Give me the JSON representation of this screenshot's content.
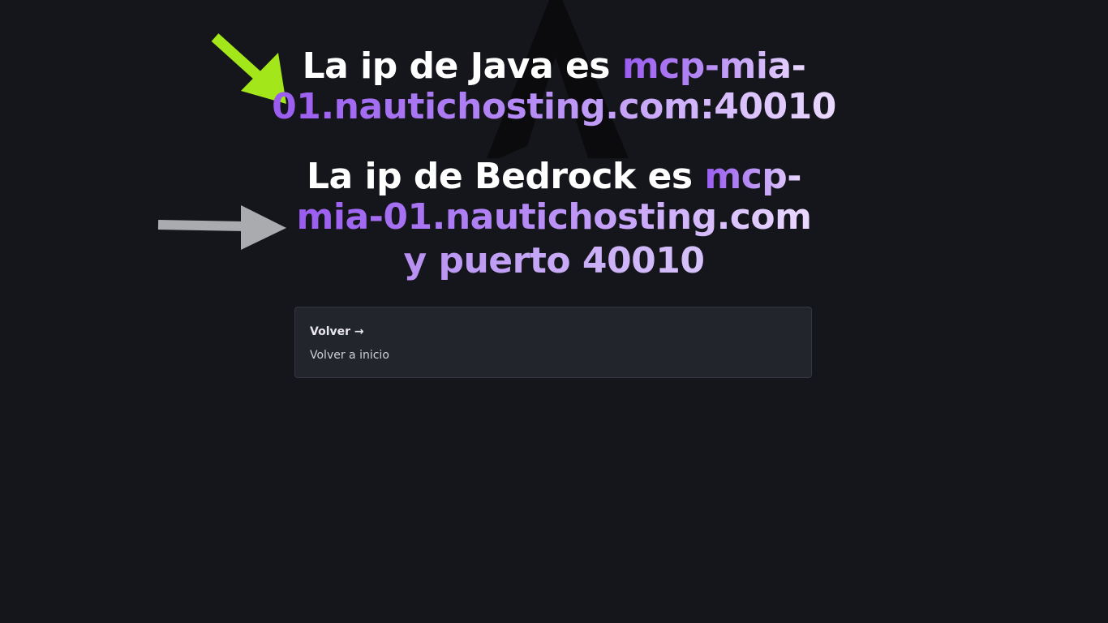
{
  "java": {
    "prefix": "La ip de Java es ",
    "address_line1": "mcp-mia-",
    "address_line2": "01.nautichosting.com:40010"
  },
  "bedrock": {
    "prefix": "La ip de Bedrock es ",
    "address_line1": "mcp-",
    "address_line2": "mia-01.nautichosting.com",
    "port_text": "y puerto 40010"
  },
  "back_card": {
    "title": "Volver →",
    "description": "Volver a inicio"
  },
  "colors": {
    "background": "#15161b",
    "card_background": "#23252d",
    "java_arrow": "#a3e61a",
    "bedrock_arrow": "#a9abae",
    "accent_start": "#9a5cf0",
    "accent_end": "#ead9ff"
  },
  "icons": {
    "java_pointer": "arrow-down-right-icon",
    "bedrock_pointer": "arrow-right-icon",
    "background": "logo-watermark-icon"
  }
}
